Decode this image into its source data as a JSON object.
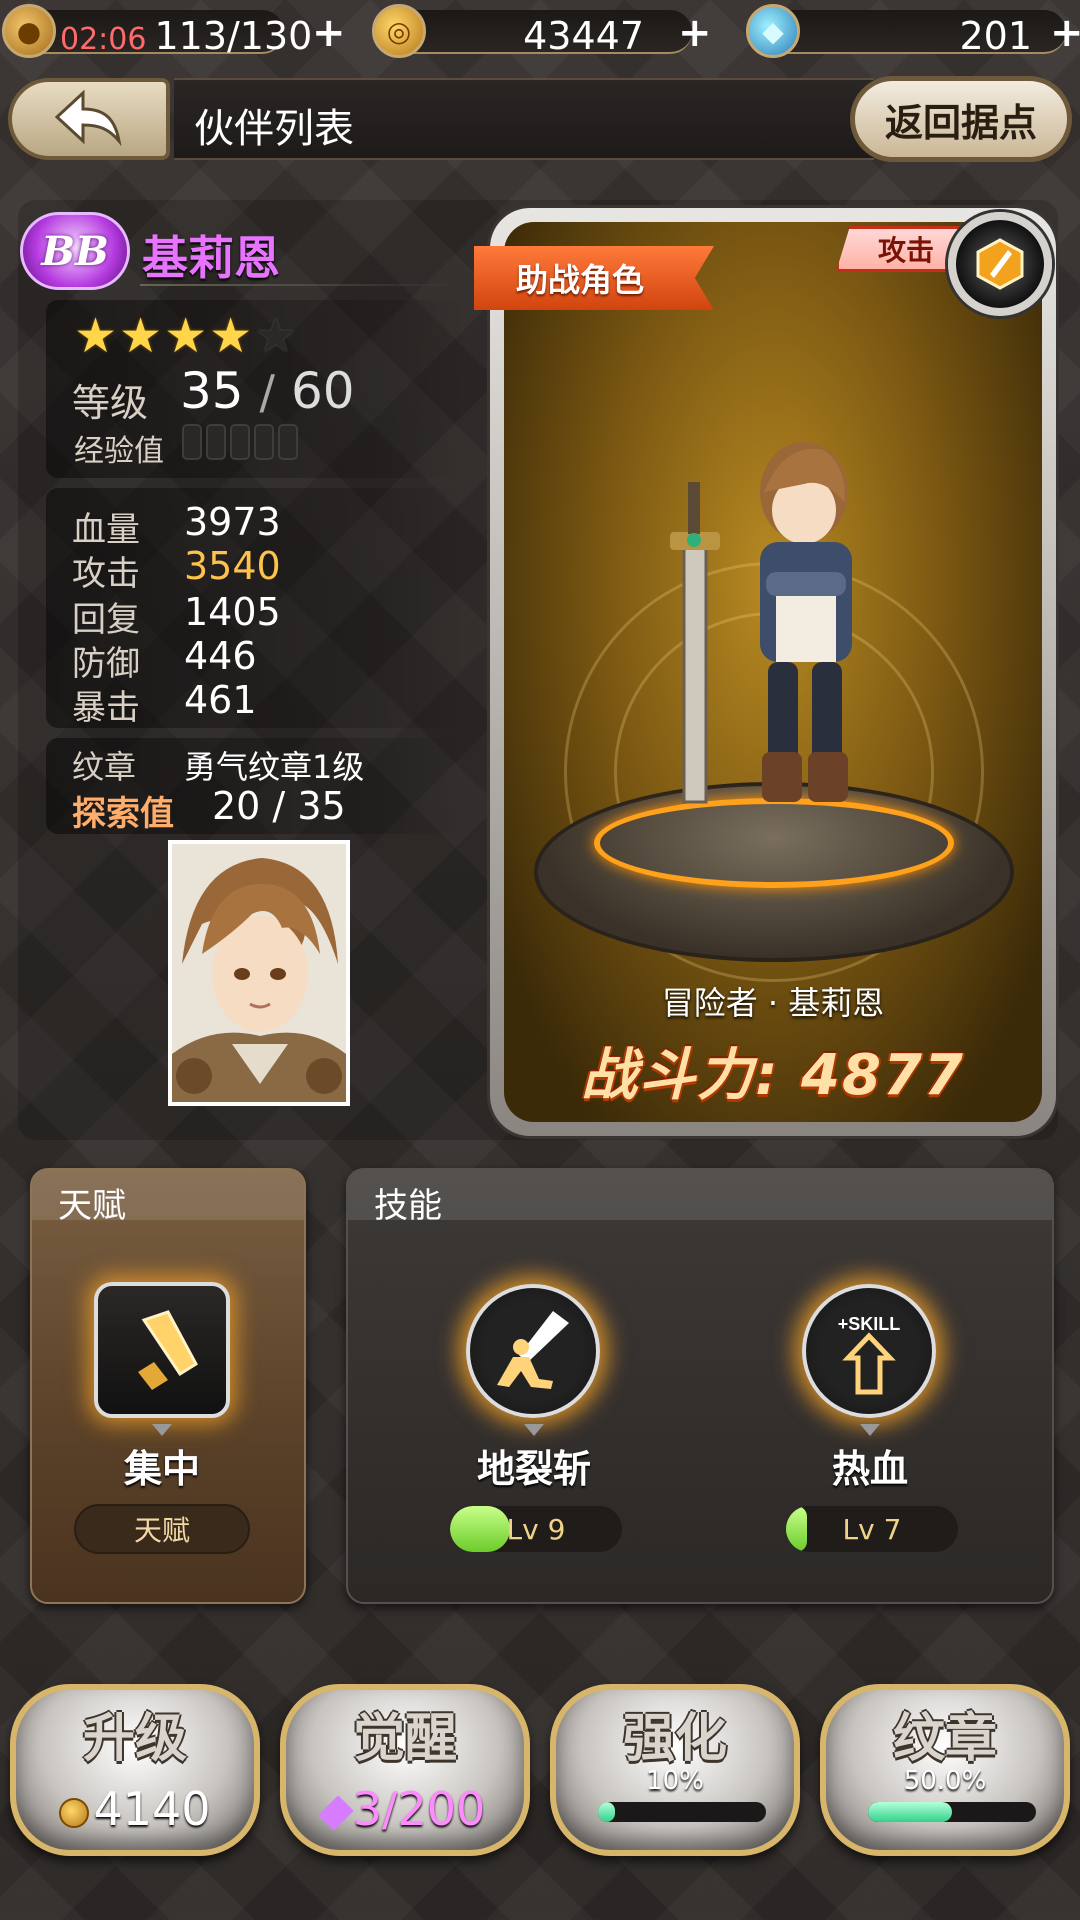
{
  "resources": {
    "stamina": {
      "timer": "02:06",
      "value": "113/130",
      "plus": "+"
    },
    "gold": {
      "value": "43447",
      "plus": "+"
    },
    "gems": {
      "value": "201",
      "plus": "+"
    }
  },
  "header": {
    "back_icon": "back-arrow-icon",
    "title": "伙伴列表",
    "home_label": "返回据点"
  },
  "character": {
    "rarity": "BB",
    "name": "基莉恩",
    "stars_filled": 4,
    "stars_total": 5,
    "level_label": "等级",
    "level": "35",
    "level_sep": "/",
    "level_max": "60",
    "exp_label": "经验值",
    "stats": [
      {
        "label": "血量",
        "value": "3973"
      },
      {
        "label": "攻击",
        "value": "3540"
      },
      {
        "label": "回复",
        "value": "1405"
      },
      {
        "label": "防御",
        "value": "446"
      },
      {
        "label": "暴击",
        "value": "461"
      }
    ],
    "emblem_label": "纹章",
    "emblem_value": "勇气纹章1级",
    "explore_label": "探索值",
    "explore_value": "20 / 35"
  },
  "card": {
    "ribbon": "助战角色",
    "role": "攻击",
    "full_name": "冒险者 · 基莉恩",
    "power": "战斗力: 4877"
  },
  "talent": {
    "title": "天赋",
    "name": "集中",
    "tag": "天赋"
  },
  "skills": {
    "title": "技能",
    "items": [
      {
        "name": "地裂斩",
        "level": "Lv 9",
        "progress": 0.35
      },
      {
        "name": "热血",
        "level": "Lv 7",
        "progress": 0.1,
        "badge": "+SKILL"
      }
    ]
  },
  "actions": [
    {
      "title": "升级",
      "sub": "4140"
    },
    {
      "title": "觉醒",
      "sub": "3/200"
    },
    {
      "title": "强化",
      "pct": "10%",
      "progress": 0.1
    },
    {
      "title": "纹章",
      "pct": "50.0%",
      "progress": 0.5
    }
  ],
  "colors": {
    "name_purple": "#e873ff",
    "attack_highlight": "#ffc24a",
    "ribbon_orange": "#d1440e"
  }
}
